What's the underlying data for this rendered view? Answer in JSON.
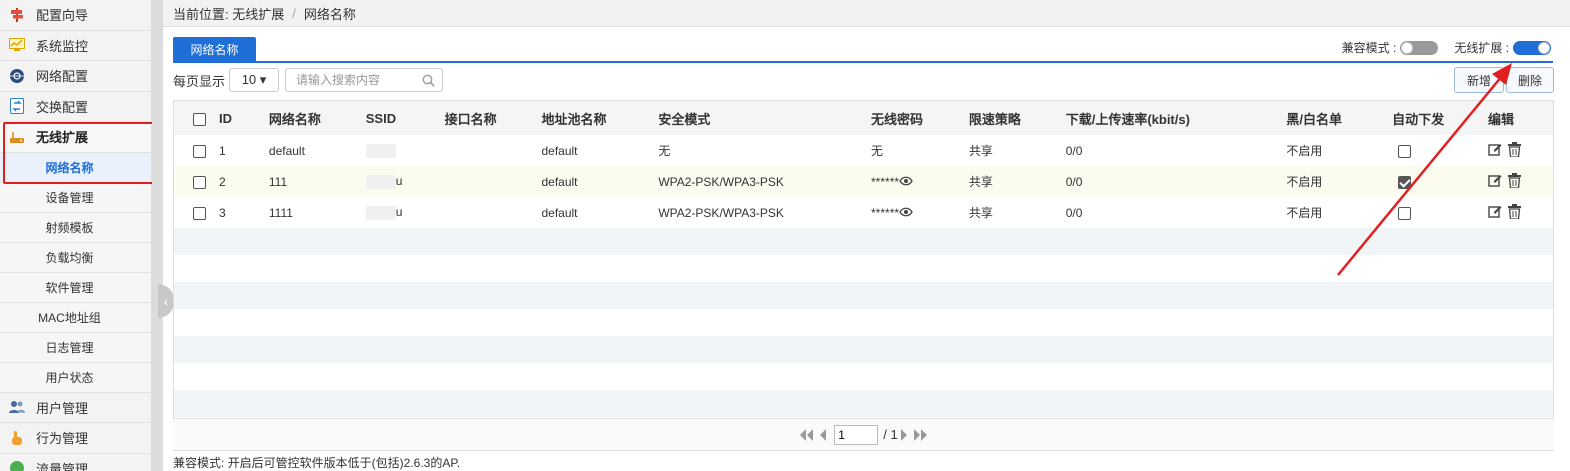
{
  "sidebar": {
    "items": [
      {
        "label": "配置向导",
        "icon": "signpost-icon",
        "name": "sidebar-item-config-wizard"
      },
      {
        "label": "系统监控",
        "icon": "monitor-chart-icon",
        "name": "sidebar-item-system-monitor"
      },
      {
        "label": "网络配置",
        "icon": "network-globe-icon",
        "name": "sidebar-item-network-config"
      },
      {
        "label": "交换配置",
        "icon": "switch-config-icon",
        "name": "sidebar-item-switch-config"
      },
      {
        "label": "无线扩展",
        "icon": "wireless-router-icon",
        "name": "sidebar-item-wireless-extension"
      }
    ],
    "subitems": [
      "网络名称",
      "设备管理",
      "射频模板",
      "负载均衡",
      "软件管理",
      "MAC地址组",
      "日志管理",
      "用户状态"
    ],
    "bottom_items": [
      {
        "label": "用户管理",
        "icon": "users-icon",
        "name": "sidebar-item-user-management"
      },
      {
        "label": "行为管理",
        "icon": "hand-pointer-icon",
        "name": "sidebar-item-behavior-management"
      },
      {
        "label": "流量管理",
        "icon": "traffic-icon",
        "name": "sidebar-item-traffic-management"
      }
    ]
  },
  "breadcrumb": {
    "prefix": "当前位置: 无线扩展",
    "separator": "/",
    "current": "网络名称"
  },
  "tab": {
    "label": "网络名称"
  },
  "toggles": {
    "compat_label": "兼容模式 :",
    "compat_on": false,
    "wireless_label": "无线扩展 :",
    "wireless_on": true
  },
  "toolbar": {
    "per_page_label": "每页显示",
    "per_page_value": "10 ▾",
    "search_placeholder": "请输入搜索内容",
    "add_label": "新增",
    "delete_label": "删除"
  },
  "table": {
    "headers": [
      "ID",
      "网络名称",
      "SSID",
      "接口名称",
      "地址池名称",
      "安全模式",
      "无线密码",
      "限速策略",
      "下载/上传速率(kbit/s)",
      "黑/白名单",
      "自动下发",
      "编辑"
    ],
    "rows": [
      {
        "id": "1",
        "name": "default",
        "ssid": "",
        "iface": "",
        "pool": "default",
        "security": "无",
        "password": "无",
        "limit": "共享",
        "rate": "0/0",
        "list": "不启用",
        "auto": false,
        "style": "r-white"
      },
      {
        "id": "2",
        "name": "111",
        "ssid": "u",
        "iface": "",
        "pool": "default",
        "security": "WPA2-PSK/WPA3-PSK",
        "password": "******",
        "limit": "共享",
        "rate": "0/0",
        "list": "不启用",
        "auto": true,
        "style": "r-yellow"
      },
      {
        "id": "3",
        "name": "1111",
        "ssid": "u",
        "iface": "",
        "pool": "default",
        "security": "WPA2-PSK/WPA3-PSK",
        "password": "******",
        "limit": "共享",
        "rate": "0/0",
        "list": "不启用",
        "auto": false,
        "style": "r-white"
      }
    ]
  },
  "pager": {
    "page": "1",
    "total": "/ 1"
  },
  "footnote": "兼容模式: 开启后可管控软件版本低于(包括)2.6.3的AP.",
  "colors": {
    "accent": "#1f6fd6",
    "highlight_box": "#e02020",
    "arrow": "#e02020"
  }
}
